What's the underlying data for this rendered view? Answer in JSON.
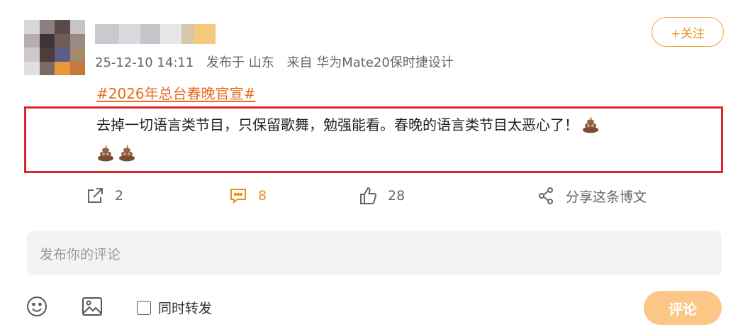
{
  "post": {
    "meta": {
      "datetime": "25-12-10 14:11",
      "published_at": "发布于 山东",
      "source": "来自 华为Mate20保时捷设计"
    },
    "follow_label": "+关注",
    "topic": "#2026年总台春晚官宣#",
    "text": "去掉一切语言类节目，只保留歌舞，勉强能看。春晚的语言类节目太恶心了！"
  },
  "actions": {
    "repost_count": "2",
    "comment_count": "8",
    "like_count": "28",
    "share_label": "分享这条博文"
  },
  "composer": {
    "placeholder": "发布你的评论",
    "repost_label": "同时转发",
    "submit_label": "评论"
  },
  "colors": {
    "accent": "#e88f1f",
    "highlight_border": "#e0242b",
    "submit_disabled": "#fbc686"
  }
}
